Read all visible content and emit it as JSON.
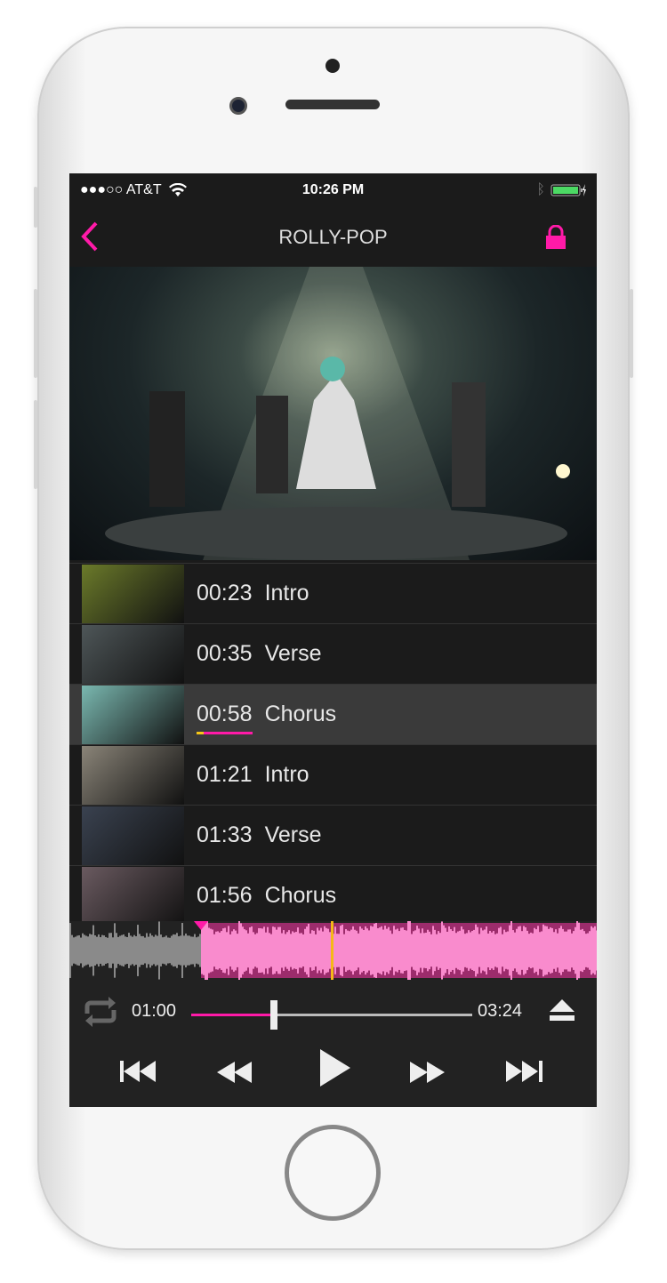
{
  "status": {
    "carrier": "●●●○○ AT&T",
    "time": "10:26 PM",
    "battery_color": "#4cd964"
  },
  "nav": {
    "title": "ROLLY-POP",
    "back_icon": "chevron-left",
    "lock_icon": "lock",
    "accent": "#ff1aa8"
  },
  "list": [
    {
      "time": "00:23",
      "label": "Intro",
      "thumb": "#6b7a2a"
    },
    {
      "time": "00:35",
      "label": "Verse",
      "thumb": "#4e5658"
    },
    {
      "time": "00:58",
      "label": "Chorus",
      "thumb": "#7ab8b0",
      "selected": true
    },
    {
      "time": "01:21",
      "label": "Intro",
      "thumb": "#8a8478"
    },
    {
      "time": "01:33",
      "label": "Verse",
      "thumb": "#3a4250"
    },
    {
      "time": "01:56",
      "label": "Chorus",
      "thumb": "#6a5a60"
    }
  ],
  "player": {
    "current": "01:00",
    "total": "03:24",
    "progress": 0.294,
    "loop_start_fraction": 0.25,
    "playhead_fraction": 0.5
  }
}
